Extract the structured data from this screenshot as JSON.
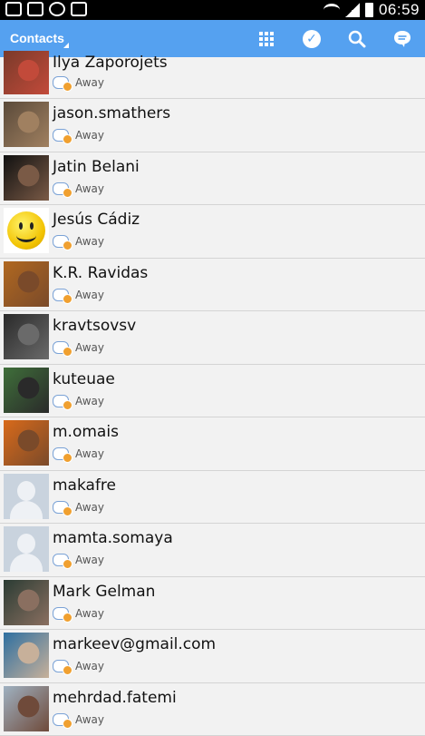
{
  "statusbar": {
    "time": "06:59"
  },
  "actionbar": {
    "title": "Contacts"
  },
  "contacts": [
    {
      "name": "Ilya Zaporojets",
      "status": "Away",
      "avatar": "photo",
      "avatar_colors": [
        "#7a3a2a",
        "#c24a3a"
      ]
    },
    {
      "name": "jason.smathers",
      "status": "Away",
      "avatar": "photo",
      "avatar_colors": [
        "#5a4a3a",
        "#a08060"
      ]
    },
    {
      "name": "Jatin Belani",
      "status": "Away",
      "avatar": "photo",
      "avatar_colors": [
        "#111111",
        "#7a5a46"
      ]
    },
    {
      "name": "Jesús Cádiz",
      "status": "Away",
      "avatar": "smiley"
    },
    {
      "name": "K.R. Ravidas",
      "status": "Away",
      "avatar": "photo",
      "avatar_colors": [
        "#b06820",
        "#7a4a2a"
      ]
    },
    {
      "name": "kravtsovsv",
      "status": "Away",
      "avatar": "photo",
      "avatar_colors": [
        "#2a2a2a",
        "#6a6a6a"
      ]
    },
    {
      "name": "kuteuae",
      "status": "Away",
      "avatar": "photo",
      "avatar_colors": [
        "#3f6f3a",
        "#2a2a2a"
      ]
    },
    {
      "name": "m.omais",
      "status": "Away",
      "avatar": "photo",
      "avatar_colors": [
        "#d86a1a",
        "#7a4a2a"
      ]
    },
    {
      "name": "makafre",
      "status": "Away",
      "avatar": "placeholder"
    },
    {
      "name": "mamta.somaya",
      "status": "Away",
      "avatar": "placeholder"
    },
    {
      "name": "Mark Gelman",
      "status": "Away",
      "avatar": "photo",
      "avatar_colors": [
        "#2b3c34",
        "#8a6f60"
      ]
    },
    {
      "name": "markeev@gmail.com",
      "status": "Away",
      "avatar": "photo",
      "avatar_colors": [
        "#2e6fa0",
        "#c7b09a"
      ]
    },
    {
      "name": "mehrdad.fatemi",
      "status": "Away",
      "avatar": "photo",
      "avatar_colors": [
        "#9fb1c1",
        "#6f4a3a"
      ]
    }
  ]
}
